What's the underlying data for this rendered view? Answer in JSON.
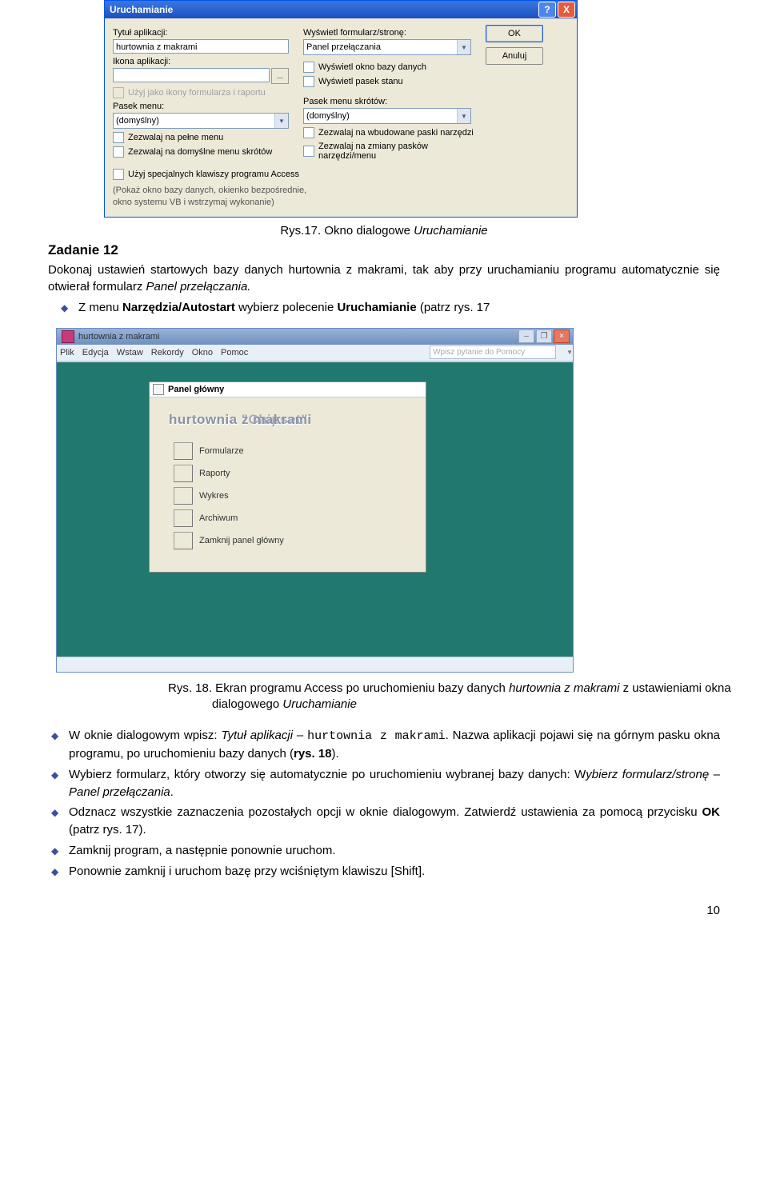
{
  "dialog1": {
    "title": "Uruchamianie",
    "help_tip": "?",
    "close_tip": "X",
    "app_title_lbl": "Tytuł aplikacji:",
    "app_title_val": "hurtownia z makrami",
    "app_icon_lbl": "Ikona aplikacji:",
    "app_icon_val": "",
    "browse": "...",
    "use_as_icons": "Użyj jako ikony formularza i raportu",
    "menu_bar_lbl": "Pasek menu:",
    "menu_bar_val": "(domyślny)",
    "allow_full_menus": "Zezwalaj na pełne menu",
    "allow_default_shortcut": "Zezwalaj na domyślne menu skrótów",
    "display_form_lbl": "Wyświetl formularz/stronę:",
    "display_form_val": "Panel przełączania",
    "show_db_window": "Wyświetl okno bazy danych",
    "show_status_bar": "Wyświetl pasek stanu",
    "shortcut_menu_lbl": "Pasek menu skrótów:",
    "shortcut_menu_val": "(domyślny)",
    "allow_builtin_toolbars": "Zezwalaj na wbudowane paski narzędzi",
    "allow_toolbar_changes": "Zezwalaj na zmiany pasków narzędzi/menu",
    "use_special_keys": "Użyj specjalnych klawiszy programu Access",
    "hint_line1": "(Pokaż okno bazy danych, okienko bezpośrednie,",
    "hint_line2": "okno systemu VB i wstrzymaj wykonanie)",
    "ok": "OK",
    "cancel": "Anuluj"
  },
  "fig17": "Rys.17. Okno dialogowe ",
  "fig17_i": "Uruchamianie",
  "task_head": "Zadanie 12",
  "task_body": "Dokonaj ustawień startowych bazy danych hurtownia z makrami, tak aby przy uruchamianiu programu automatycznie się otwierał formularz ",
  "task_body_i": "Panel przełączania.",
  "bullet1a": "Z menu ",
  "bullet1b": "Narzędzia/Autostart ",
  "bullet1c": "wybierz polecenie ",
  "bullet1d": "Uruchamianie ",
  "bullet1e": "(patrz rys. 17",
  "access": {
    "title": "hurtownia z makrami",
    "menu": [
      "Plik",
      "Edycja",
      "Wstaw",
      "Rekordy",
      "Okno",
      "Pomoc"
    ],
    "ask": "Wpisz pytanie do Pomocy",
    "panel_title": "Panel główny",
    "heading_ghost": "hurtownia \"Chipset\"",
    "heading": "hurtownia z makrami",
    "items": [
      "Formularze",
      "Raporty",
      "Wykres",
      "Archiwum",
      "Zamknij panel główny"
    ]
  },
  "fig18a": "Rys. 18. Ekran programu Access po uruchomieniu bazy danych ",
  "fig18b": "hurtownia z makrami",
  "fig18c": " z ustawieniami okna dialogowego ",
  "fig18d": "Uruchamianie",
  "b2a": "W oknie dialogowym wpisz: ",
  "b2b": "Tytuł aplikacji – ",
  "b2c": "hurtownia z makrami",
  "b2d": ". Nazwa aplikacji pojawi się na górnym pasku okna programu, po uruchomieniu bazy danych (",
  "b2e": "rys. 18",
  "b2f": ").",
  "b3a": "Wybierz formularz, który otworzy się automatycznie po uruchomieniu wybranej bazy danych: W",
  "b3b": "ybierz formularz/stronę – Panel przełączania",
  "b3c": ".",
  "b4a": "Odznacz wszystkie zaznaczenia pozostałych opcji w oknie dialogowym. Zatwierdź ustawienia za pomocą przycisku ",
  "b4b": "OK",
  "b4c": " (patrz rys. 17).",
  "b5": "Zamknij program, a następnie ponownie uruchom.",
  "b6": "Ponownie zamknij i uruchom bazę przy wciśniętym klawiszu [Shift].",
  "page": "10"
}
